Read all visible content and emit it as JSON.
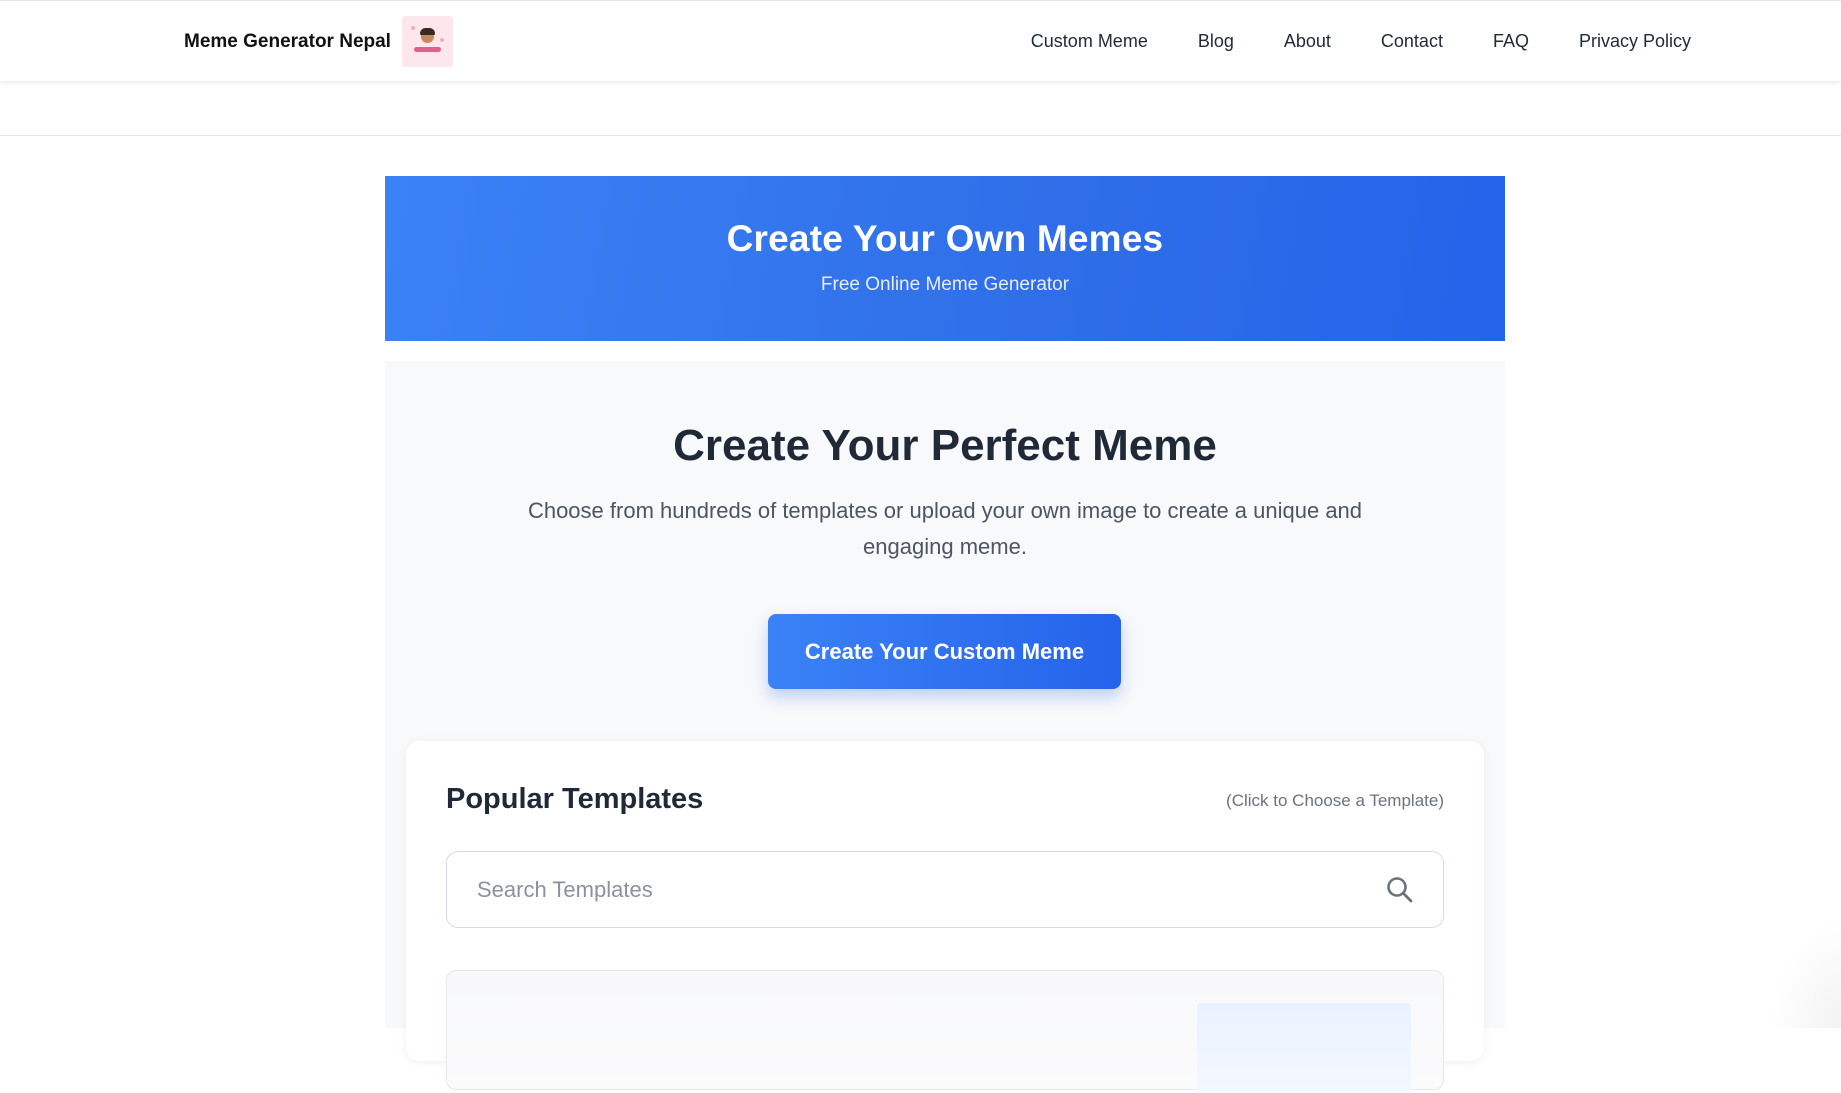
{
  "header": {
    "brand_name": "Meme Generator Nepal",
    "logo_icon": "brand-logo-image",
    "nav": [
      {
        "label": "Custom Meme"
      },
      {
        "label": "Blog"
      },
      {
        "label": "About"
      },
      {
        "label": "Contact"
      },
      {
        "label": "FAQ"
      },
      {
        "label": "Privacy Policy"
      }
    ]
  },
  "hero": {
    "title": "Create Your Own Memes",
    "subtitle": "Free Online Meme Generator"
  },
  "main": {
    "title": "Create Your Perfect Meme",
    "description": "Choose from hundreds of templates or upload your own image to create a unique and engaging meme.",
    "cta_label": "Create Your Custom Meme"
  },
  "templates": {
    "title": "Popular Templates",
    "hint": "(Click to Choose a Template)",
    "search": {
      "placeholder": "Search Templates",
      "value": "",
      "icon": "search-icon"
    }
  },
  "colors": {
    "accent": "#3b82f6",
    "accent_dark": "#2563eb",
    "text_dark": "#1f2937",
    "text_muted": "#4b5563",
    "panel_bg": "#f8f9fb"
  }
}
